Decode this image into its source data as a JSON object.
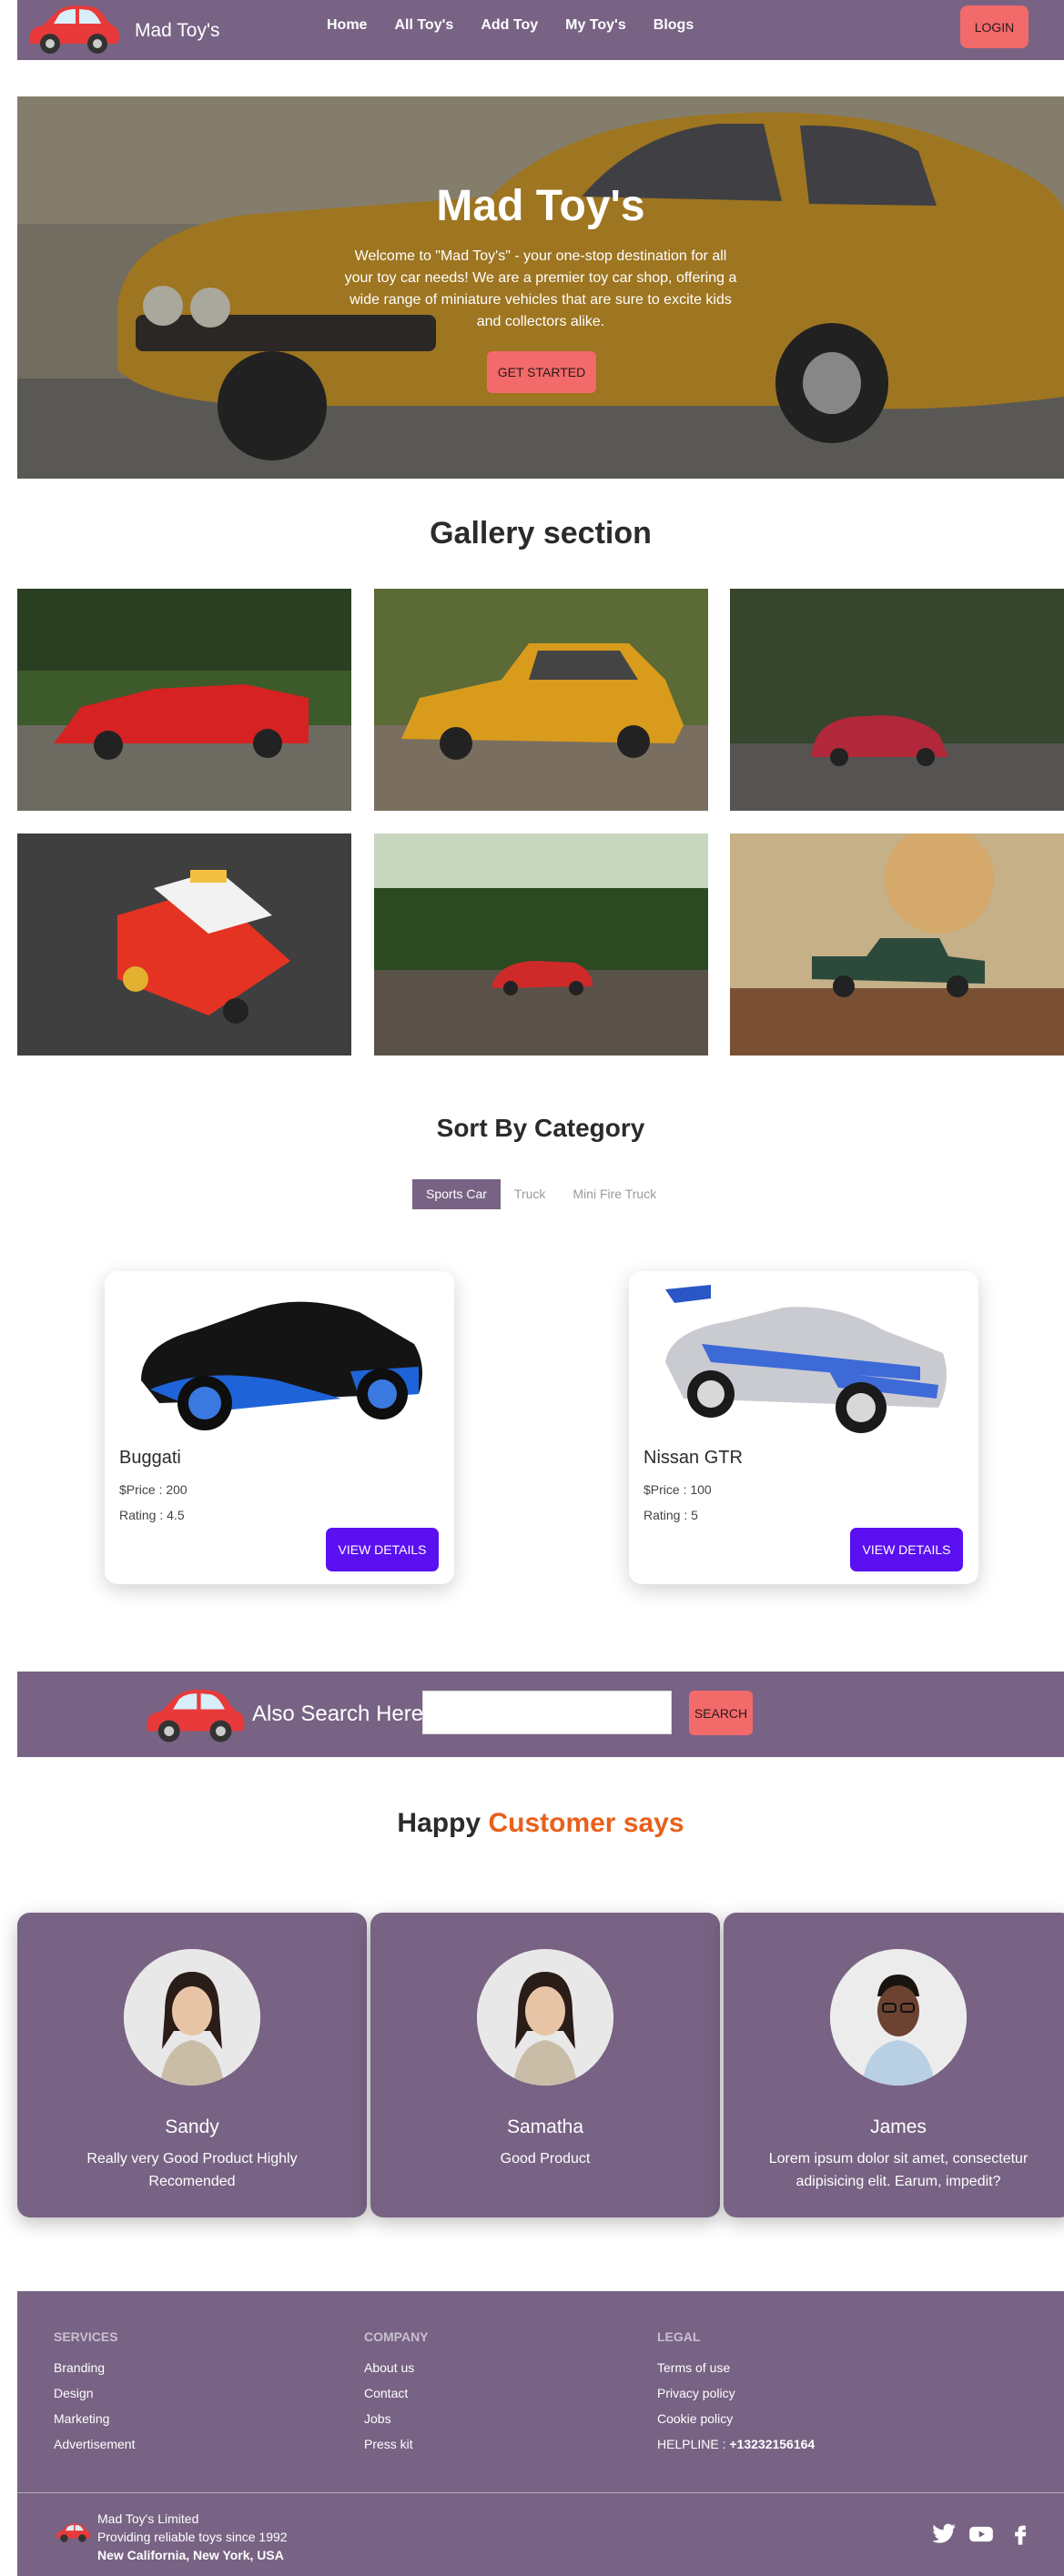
{
  "navbar": {
    "brand": "Mad Toy's",
    "links": [
      "Home",
      "All Toy's",
      "Add Toy",
      "My Toy's",
      "Blogs"
    ],
    "login_label": "LOGIN"
  },
  "hero": {
    "title": "Mad Toy's",
    "text": "Welcome to \"Mad Toy's\" - your one-stop destination for all your toy car needs! We are a premier toy car shop, offering a wide range of miniature vehicles that are sure to excite kids and collectors alike.",
    "button": "GET STARTED"
  },
  "gallery": {
    "title": "Gallery section"
  },
  "category": {
    "title": "Sort By Category",
    "tabs": [
      "Sports Car",
      "Truck",
      "Mini Fire Truck"
    ],
    "cards": [
      {
        "name": "Buggati",
        "price": "$Price : 200",
        "rating": "Rating : 4.5",
        "button": "VIEW DETAILS"
      },
      {
        "name": "Nissan GTR",
        "price": "$Price : 100",
        "rating": "Rating : 5",
        "button": "VIEW DETAILS"
      }
    ]
  },
  "search": {
    "label": "Also Search Here",
    "value": "",
    "button": "SEARCH"
  },
  "testimonials": {
    "title_part1": "Happy",
    "title_part2": "Customer says",
    "accent_color": "#e8601c",
    "items": [
      {
        "name": "Sandy",
        "text": "Really very Good Product Highly Recomended"
      },
      {
        "name": "Samatha",
        "text": "Good Product"
      },
      {
        "name": "James",
        "text": "Lorem ipsum dolor sit amet, consectetur adipisicing elit. Earum, impedit?"
      }
    ]
  },
  "footer": {
    "services": {
      "title": "SERVICES",
      "links": [
        "Branding",
        "Design",
        "Marketing",
        "Advertisement"
      ]
    },
    "company": {
      "title": "COMPANY",
      "links": [
        "About us",
        "Contact",
        "Jobs",
        "Press kit"
      ]
    },
    "legal": {
      "title": "LEGAL",
      "links": [
        "Terms of use",
        "Privacy policy",
        "Cookie policy"
      ],
      "helpline_label": "HELPLINE :",
      "helpline_number": "+13232156164"
    },
    "company_name": "Mad Toy's Limited",
    "tagline": "Providing reliable toys since 1992",
    "location": "New California, New York, USA",
    "social_icons": [
      "twitter-icon",
      "youtube-icon",
      "facebook-icon"
    ]
  },
  "colors": {
    "primary": "#786384",
    "accent": "#f26a6a",
    "button": "#5a10f0"
  }
}
